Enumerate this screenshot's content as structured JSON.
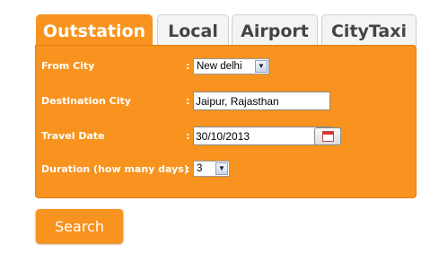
{
  "tabs": [
    "Outstation",
    "Local",
    "Airport",
    "CityTaxi"
  ],
  "active_tab": "Outstation",
  "form": {
    "from_city": {
      "label": "From City",
      "value": "New delhi"
    },
    "destination_city": {
      "label": "Destination City",
      "value": "Jaipur, Rajasthan"
    },
    "travel_date": {
      "label": "Travel Date",
      "value": "30/10/2013"
    },
    "duration": {
      "label": "Duration (how many days)",
      "value": "3"
    },
    "colon": ":"
  },
  "search_label": "Search",
  "icons": {
    "calendar": "calendar-icon",
    "dropdown": "chevron-down-icon"
  },
  "colors": {
    "accent": "#f7931e",
    "tab_inactive": "#f4f4f4",
    "text_inactive": "#444444"
  }
}
